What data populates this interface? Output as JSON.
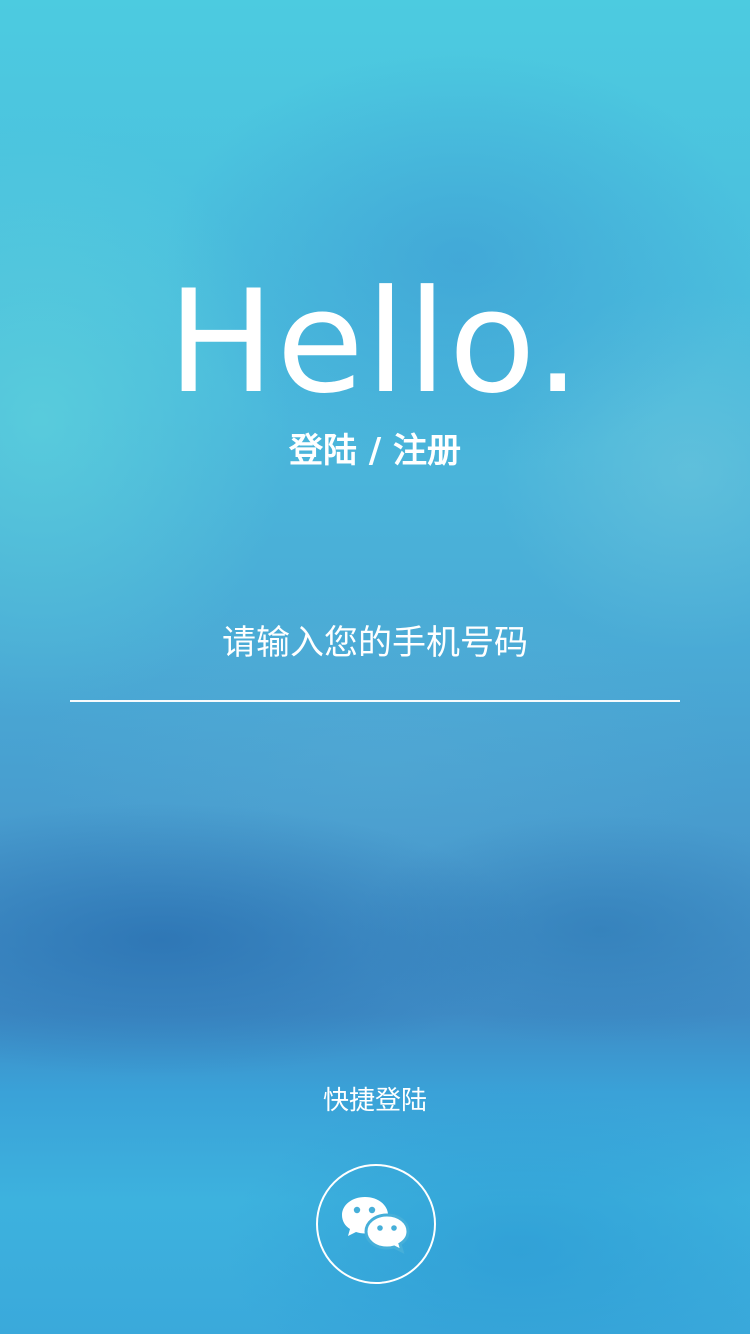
{
  "hero": {
    "greeting": "Hello.",
    "subtitle": "登陆 / 注册"
  },
  "form": {
    "phone_placeholder": "请输入您的手机号码",
    "phone_value": ""
  },
  "quick_login": {
    "label": "快捷登陆",
    "options": [
      {
        "icon": "wechat-icon"
      }
    ]
  },
  "colors": {
    "background_top": "#4ccbe0",
    "background_mid": "#4798cc",
    "background_bottom": "#3aa9db",
    "foreground": "#ffffff"
  }
}
